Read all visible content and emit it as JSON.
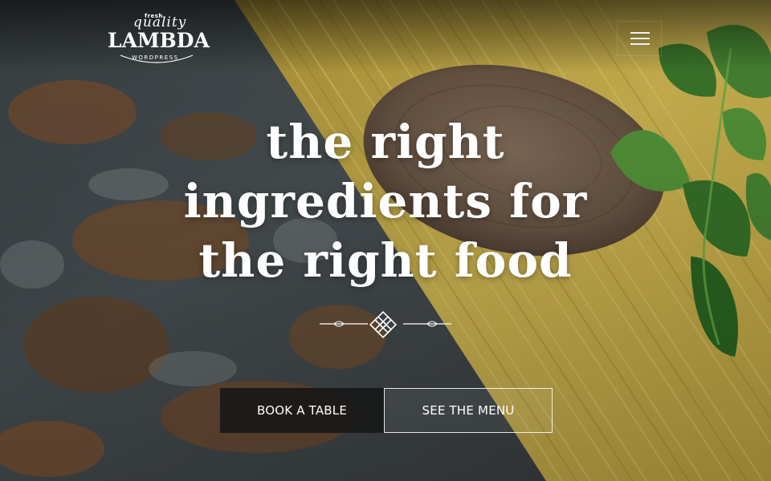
{
  "logo": {
    "top_small": "fresh",
    "script": "quality",
    "name": "LAMBDA",
    "sub": "WORDPRESS"
  },
  "nav": {
    "menu_icon": "hamburger-icon"
  },
  "hero": {
    "headline_lines": [
      "the right",
      "ingredients for",
      "the right food"
    ],
    "divider_icon": "ornament-divider-icon",
    "buttons": {
      "book": "BOOK A TABLE",
      "menu": "SEE THE MENU"
    }
  },
  "colors": {
    "stone": "#4a5256",
    "rust": "#8a5a34",
    "pasta": "#e2c65a",
    "spoon": "#7a6350",
    "basil": "#3f7f2e",
    "button_dark": "#161616",
    "text": "#ffffff"
  }
}
